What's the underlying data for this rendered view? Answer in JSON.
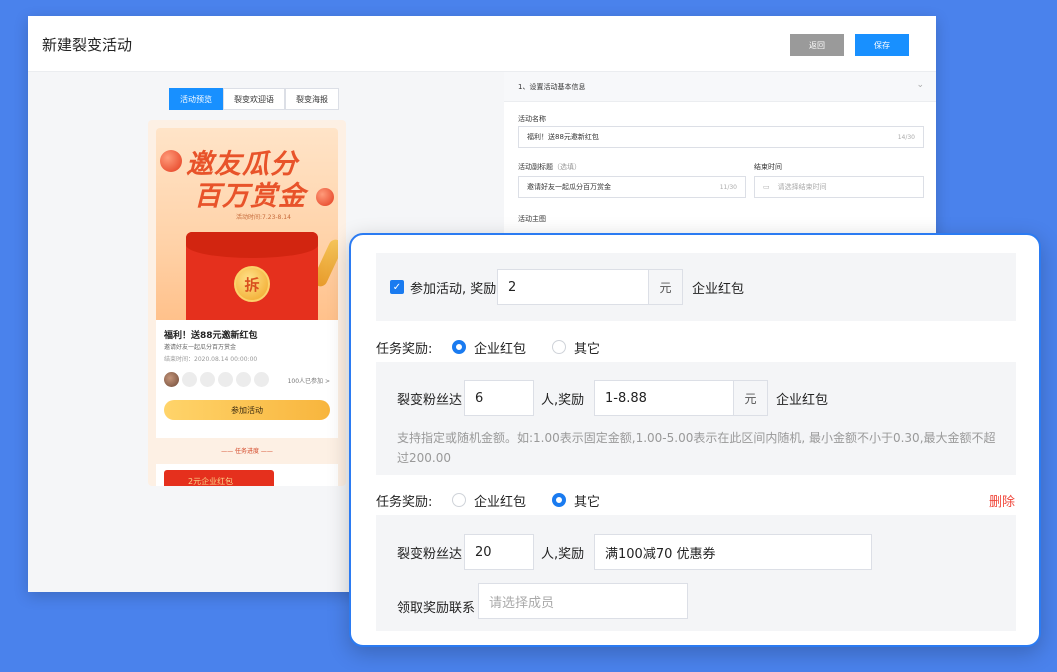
{
  "window": {
    "title": "新建裂变活动",
    "back_label": "返回",
    "save_label": "保存"
  },
  "preview": {
    "tabs": [
      {
        "label": "活动预览",
        "active": true
      },
      {
        "label": "裂变欢迎语",
        "active": false
      },
      {
        "label": "裂变海报",
        "active": false
      }
    ],
    "poster": {
      "line1": "邀友瓜分",
      "line2": "百万赏金",
      "date": "活动时间:7.23-8.14",
      "coin_char": "拆"
    },
    "card": {
      "title": "福利！送88元邀新红包",
      "subtitle": "邀请好友一起瓜分百万赏金",
      "end_time": "结束时间：2020.08.14 00:00:00",
      "joined": "100人已参加 >",
      "join_button": "参加活动"
    },
    "progress_label": "—— 任务进度 ——",
    "task_card_text": "2元企业红包"
  },
  "form": {
    "section_title": "1、设置活动基本信息",
    "name_label": "活动名称",
    "name_value": "福利！送88元邀新红包",
    "name_count": "14/30",
    "subtitle_label": "活动副标题",
    "subtitle_optional": "（选填）",
    "subtitle_value": "邀请好友一起瓜分百万赏金",
    "subtitle_count": "11/30",
    "end_label": "结束时间",
    "end_placeholder": "请选择结束时间",
    "theme_label": "活动主图"
  },
  "overlay": {
    "participate": {
      "label": "参加活动, 奖励",
      "value": "2",
      "unit": "元",
      "type": "企业红包",
      "checked": true
    },
    "task1": {
      "label": "任务奖励:",
      "options": [
        "企业红包",
        "其它"
      ],
      "selected": "企业红包",
      "fans_label": "裂变粉丝达",
      "fans_value": "6",
      "reward_label": "人,奖励",
      "reward_value": "1-8.88",
      "unit": "元",
      "type": "企业红包",
      "hint": "支持指定或随机金额。如:1.00表示固定金额,1.00-5.00表示在此区间内随机, 最小金额不小于0.30,最大金额不超过200.00"
    },
    "task2": {
      "label": "任务奖励:",
      "options": [
        "企业红包",
        "其它"
      ],
      "selected": "其它",
      "delete_label": "删除",
      "fans_label": "裂变粉丝达",
      "fans_value": "20",
      "reward_label": "人,奖励",
      "reward_value": "满100减70 优惠券",
      "contact_label": "领取奖励联系",
      "contact_placeholder": "请选择成员"
    }
  },
  "colors": {
    "primary": "#1a7bf0",
    "background": "#4a82ec",
    "danger": "#f0463a",
    "red_packet": "#e5301d"
  }
}
